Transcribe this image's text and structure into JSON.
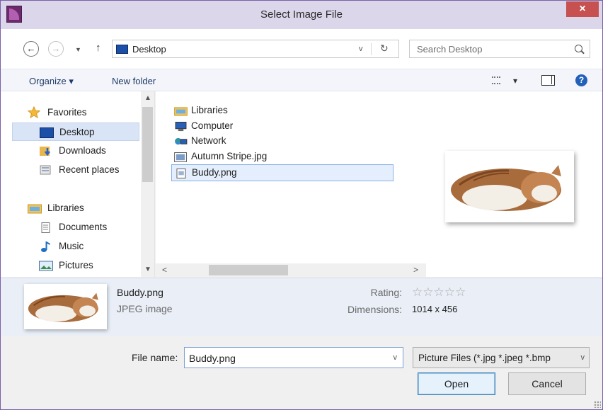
{
  "window": {
    "title": "Select Image File",
    "close": "×"
  },
  "nav": {
    "back": "←",
    "forward": "→",
    "up": "↑"
  },
  "address": {
    "location": "Desktop",
    "dropdown": "v",
    "refresh": "↻"
  },
  "search": {
    "placeholder": "Search Desktop"
  },
  "commands": {
    "organize": "Organize ▾",
    "new_folder": "New folder",
    "view_dropdown": "▾",
    "help": "?"
  },
  "sidebar": {
    "items": [
      {
        "label": "Favorites",
        "icon": "star-icon"
      },
      {
        "label": "Desktop",
        "icon": "desktop-icon",
        "selected": true
      },
      {
        "label": "Downloads",
        "icon": "downloads-icon"
      },
      {
        "label": "Recent places",
        "icon": "recent-places-icon"
      },
      {
        "label": "Libraries",
        "icon": "libraries-icon"
      },
      {
        "label": "Documents",
        "icon": "documents-icon"
      },
      {
        "label": "Music",
        "icon": "music-icon"
      },
      {
        "label": "Pictures",
        "icon": "pictures-icon"
      }
    ]
  },
  "files": [
    {
      "name": "Libraries",
      "icon": "libraries-icon"
    },
    {
      "name": "Computer",
      "icon": "computer-icon"
    },
    {
      "name": "Network",
      "icon": "network-icon"
    },
    {
      "name": "Autumn Stripe.jpg",
      "icon": "image-file-icon"
    },
    {
      "name": "Buddy.png",
      "icon": "png-file-icon",
      "selected": true
    }
  ],
  "details": {
    "name": "Buddy.png",
    "type": "JPEG image",
    "rating_label": "Rating:",
    "rating_stars": "☆☆☆☆☆",
    "rating_value": 0,
    "dimensions_label": "Dimensions:",
    "dimensions": "1014 x 456"
  },
  "bottom": {
    "filename_label": "File name:",
    "filename": "Buddy.png",
    "filter": "Picture Files (*.jpg *.jpeg *.bmp",
    "open": "Open",
    "cancel": "Cancel"
  },
  "colors": {
    "selection": "#d9e4f6",
    "details_bg": "#e9eef7",
    "title_bg": "#dcd6ea",
    "close_red": "#c75050"
  }
}
